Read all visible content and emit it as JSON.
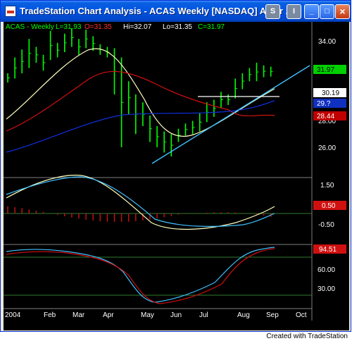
{
  "window": {
    "title": "TradeStation Chart Analysis - ACAS  Weekly  [NASDAQ] Amer ...",
    "buttons": {
      "s": "S",
      "i": "I",
      "minimize": "_",
      "maximize": "□",
      "close": "×"
    }
  },
  "header": {
    "symbol": "ACAS - Weekly",
    "last": "L=31.93",
    "open": "O=31.35",
    "hi": "Hi=32.07",
    "lo": "Lo=31.35",
    "close": "C=31.97"
  },
  "price_axis": {
    "ticks": [
      "34.00",
      "28.00",
      "26.00"
    ]
  },
  "price_tags": [
    {
      "label": "31.97",
      "bg": "#00d000",
      "fg": "#000000"
    },
    {
      "label": "30.19",
      "bg": "#ffffff",
      "fg": "#000000"
    },
    {
      "label": "29.?",
      "bg": "#1030c0",
      "fg": "#ffffff"
    },
    {
      "label": "28.44",
      "bg": "#c00000",
      "fg": "#ffffff"
    }
  ],
  "macd_axis": {
    "ticks": [
      "1.50",
      "-0.50"
    ],
    "tag": "0.50",
    "tag_bg": "#d01010"
  },
  "stoch_axis": {
    "ticks": [
      "60.00",
      "30.00"
    ],
    "tag": "94.51",
    "tag_bg": "#d01010"
  },
  "time_axis": {
    "labels": [
      "2004",
      "Feb",
      "Mar",
      "Apr",
      "May",
      "Jun",
      "Jul",
      "Aug",
      "Sep",
      "Oct"
    ]
  },
  "status_text": "Created with TradeStation",
  "colors": {
    "bars": "#00ff00",
    "sma_fast": "#ffffc0",
    "sma_mid": "#d01010",
    "sma_slow": "#1030e0",
    "trendline": "#40c0ff",
    "grid": "#2e7d2e"
  },
  "chart_data": {
    "type": "table",
    "series": [
      {
        "name": "ACAS - Weekly",
        "last": 31.97,
        "open": 31.35,
        "high": 32.07,
        "low": 31.35,
        "close": 31.97
      }
    ],
    "ylim": [
      25,
      35.5
    ]
  }
}
